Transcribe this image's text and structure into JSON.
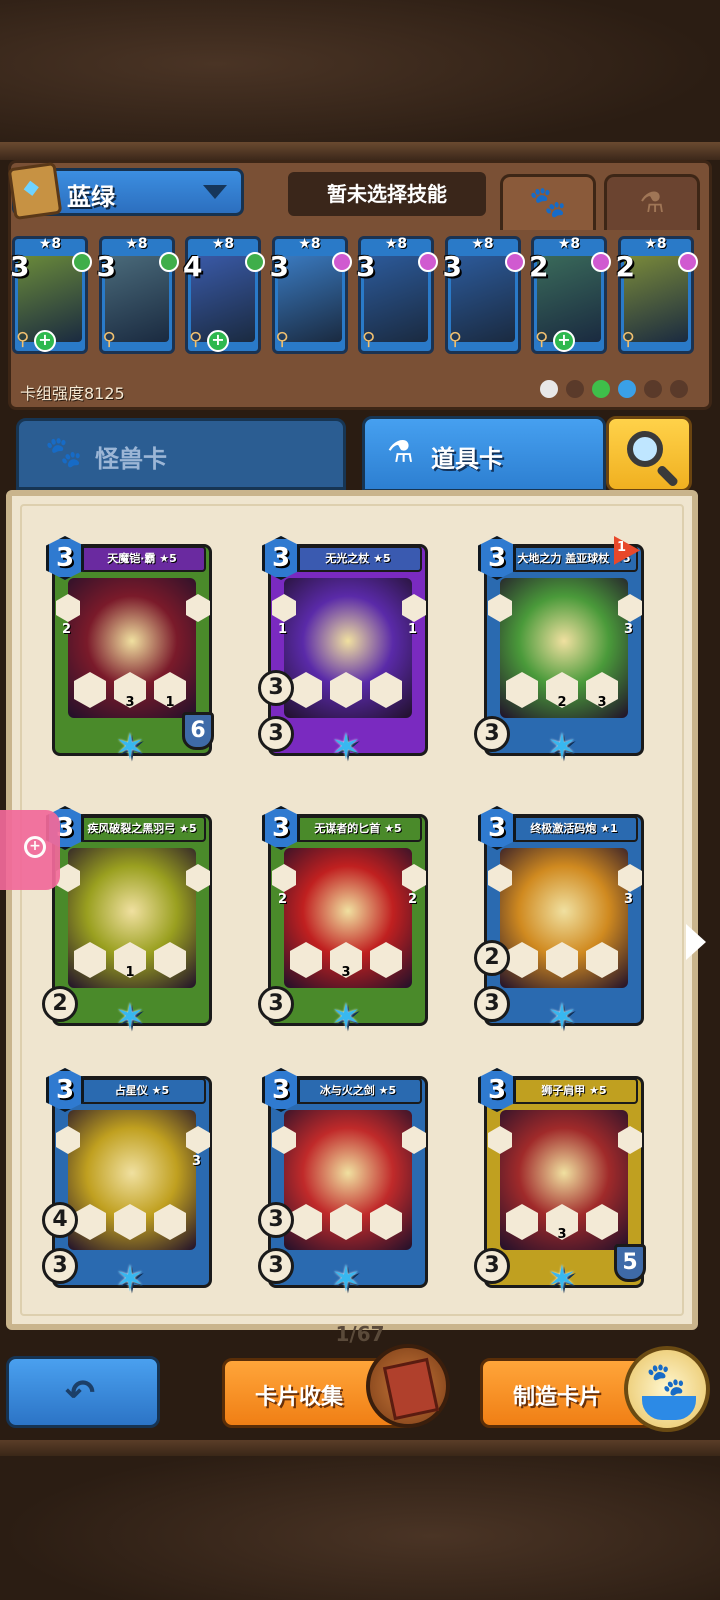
{
  "header": {
    "deck_name": "蓝绿",
    "skill_label": "暂未选择技能",
    "tab_monster_icon": "paw-icon",
    "tab_potion_icon": "potion-icon"
  },
  "deck_cards": [
    {
      "level": "★8",
      "cost": "3",
      "element": "#3fae4a",
      "art": "#6a8a3a",
      "plus": true
    },
    {
      "level": "★8",
      "cost": "3",
      "element": "#3fae4a",
      "art": "#4a6a7a",
      "plus": false
    },
    {
      "level": "★8",
      "cost": "4",
      "element": "#3fae4a",
      "art": "#3a5aa8",
      "plus": true
    },
    {
      "level": "★8",
      "cost": "3",
      "element": "#d05ad0",
      "art": "#3a7ac0",
      "plus": false
    },
    {
      "level": "★8",
      "cost": "3",
      "element": "#d05ad0",
      "art": "#2c5a9a",
      "plus": false
    },
    {
      "level": "★8",
      "cost": "3",
      "element": "#d05ad0",
      "art": "#2c5a9a",
      "plus": false
    },
    {
      "level": "★8",
      "cost": "2",
      "element": "#d05ad0",
      "art": "#3a6a5a",
      "plus": true
    },
    {
      "level": "★8",
      "cost": "2",
      "element": "#d05ad0",
      "art": "#7a8a3a",
      "plus": false
    }
  ],
  "deck_strength": "卡组强度8125",
  "element_filters": [
    "#e8e8e8",
    "#5a3a2a",
    "#3fbf4a",
    "#3aa0e8",
    "#5a3a2a",
    "#5a3a2a"
  ],
  "tabs": {
    "monster_label": "怪兽卡",
    "item_label": "道具卡"
  },
  "cards": [
    {
      "name": "天魔铠·霸 ★5",
      "cost": "3",
      "banner": "#6a2aa0",
      "frame": "#4a8a2a",
      "art": "#7a1a2a",
      "hex": [
        "",
        "3",
        "1"
      ],
      "left_num": "2",
      "right_num": "",
      "stat_a": "",
      "stat_b": "",
      "shield": "6"
    },
    {
      "name": "无光之杖 ★5",
      "cost": "3",
      "banner": "#3a5ab0",
      "frame": "#7a2ac0",
      "art": "#5a2aa8",
      "hex": [
        "",
        "",
        ""
      ],
      "left_num": "1",
      "right_num": "1",
      "stat_a": "3",
      "stat_b": "3",
      "shield": ""
    },
    {
      "name": "大地之力 盖亚球杖 ★5",
      "cost": "3",
      "banner": "#2a6ab0",
      "frame": "#2a6ab0",
      "art": "#4a9a3a",
      "hex": [
        "",
        "2",
        "3"
      ],
      "left_num": "",
      "right_num": "3",
      "stat_a": "",
      "stat_b": "3",
      "shield": "",
      "flag": "1"
    },
    {
      "name": "疾风破裂之黑羽弓 ★5",
      "cost": "3",
      "banner": "#4a8a2a",
      "frame": "#4a8a2a",
      "art": "#9aa020",
      "hex": [
        "",
        "1",
        ""
      ],
      "left_num": "",
      "right_num": "",
      "stat_a": "",
      "stat_b": "2",
      "shield": ""
    },
    {
      "name": "无谋者的匕首 ★5",
      "cost": "3",
      "banner": "#4a8a2a",
      "frame": "#4a8a2a",
      "art": "#c02020",
      "hex": [
        "",
        "3",
        ""
      ],
      "left_num": "2",
      "right_num": "2",
      "stat_a": "",
      "stat_b": "3",
      "shield": ""
    },
    {
      "name": "终极激活码炮 ★1",
      "cost": "3",
      "banner": "#2a6ab0",
      "frame": "#2a6ab0",
      "art": "#d08a20",
      "hex": [
        "",
        "",
        ""
      ],
      "left_num": "",
      "right_num": "3",
      "stat_a": "2",
      "stat_b": "3",
      "shield": ""
    },
    {
      "name": "占星仪 ★5",
      "cost": "3",
      "banner": "#2a6ab0",
      "frame": "#2a6ab0",
      "art": "#c0a020",
      "hex": [
        "",
        "",
        ""
      ],
      "left_num": "",
      "right_num": "3",
      "stat_a": "4",
      "stat_b": "3",
      "shield": ""
    },
    {
      "name": "冰与火之剑 ★5",
      "cost": "3",
      "banner": "#2a6ab0",
      "frame": "#2a6ab0",
      "art": "#c02a2a",
      "hex": [
        "",
        "",
        ""
      ],
      "left_num": "",
      "right_num": "",
      "stat_a": "3",
      "stat_b": "3",
      "shield": ""
    },
    {
      "name": "狮子肩甲 ★5",
      "cost": "3",
      "banner": "#c0a020",
      "frame": "#c0a020",
      "art": "#a02a2a",
      "hex": [
        "",
        "3",
        ""
      ],
      "left_num": "",
      "right_num": "",
      "stat_a": "",
      "stat_b": "3",
      "shield": "5"
    }
  ],
  "page_indicator": "1/67",
  "bottom": {
    "collect_label": "卡片收集",
    "craft_label": "制造卡片"
  }
}
